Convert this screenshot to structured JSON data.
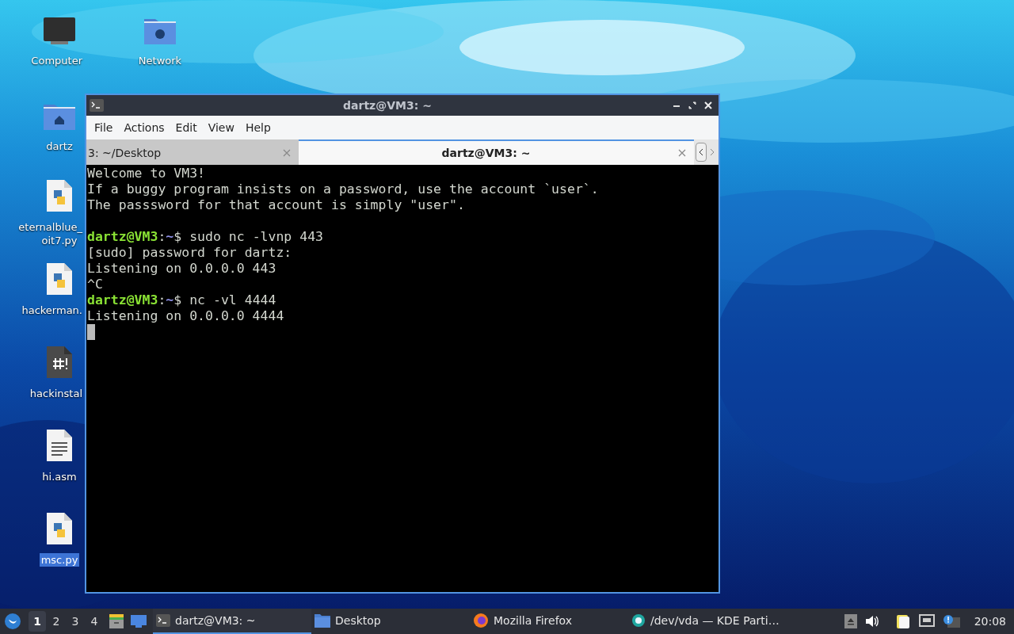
{
  "desktop_icons": [
    {
      "kind": "monitor",
      "label": [
        "Computer"
      ],
      "selected": false
    },
    {
      "kind": "network-folder",
      "label": [
        "Network"
      ],
      "selected": false
    },
    {
      "kind": "home-folder",
      "label": [
        "dartz"
      ],
      "selected": false
    },
    {
      "kind": "python",
      "label": [
        "eternalblue_",
        "oit7.py"
      ],
      "selected": false
    },
    {
      "kind": "python",
      "label": [
        "hackerman."
      ],
      "selected": false
    },
    {
      "kind": "script",
      "label": [
        "hackinstal"
      ],
      "selected": false
    },
    {
      "kind": "text",
      "label": [
        "hi.asm"
      ],
      "selected": false
    },
    {
      "kind": "python",
      "label": [
        "msc.py"
      ],
      "selected": true
    }
  ],
  "window": {
    "title": "dartz@VM3: ~",
    "menu": [
      "File",
      "Actions",
      "Edit",
      "View",
      "Help"
    ],
    "tabs": [
      {
        "label": "3: ~/Desktop",
        "selected": false
      },
      {
        "label": "dartz@VM3: ~",
        "selected": true
      }
    ],
    "terminal": [
      {
        "kind": "output",
        "text": "Welcome to VM3!"
      },
      {
        "kind": "output",
        "text": "If a buggy program insists on a password, use the account `user`."
      },
      {
        "kind": "output",
        "text": "The passsword for that account is simply \"user\"."
      },
      {
        "kind": "blank"
      },
      {
        "kind": "prompt",
        "user": "dartz@VM3",
        "separator": ":",
        "path": "~",
        "symbol": "$",
        "command": "sudo nc -lvnp 443"
      },
      {
        "kind": "output",
        "text": "[sudo] password for dartz:"
      },
      {
        "kind": "output",
        "text": "Listening on 0.0.0.0 443"
      },
      {
        "kind": "output",
        "text": "^C"
      },
      {
        "kind": "prompt",
        "user": "dartz@VM3",
        "separator": ":",
        "path": "~",
        "symbol": "$",
        "command": "nc -vl 4444"
      },
      {
        "kind": "output",
        "text": "Listening on 0.0.0.0 4444"
      },
      {
        "kind": "cursor"
      }
    ]
  },
  "taskbar": {
    "workspaces": [
      {
        "label": "1",
        "selected": true
      },
      {
        "label": "2",
        "selected": false
      },
      {
        "label": "3",
        "selected": false
      },
      {
        "label": "4",
        "selected": false
      }
    ],
    "tasks": [
      {
        "kind": "terminal",
        "label": "dartz@VM3: ~",
        "selected": true
      },
      {
        "kind": "folder",
        "label": "Desktop",
        "selected": false
      },
      {
        "kind": "firefox",
        "label": "Mozilla Firefox",
        "selected": false
      },
      {
        "kind": "partition",
        "label": "/dev/vda — KDE Parti…",
        "selected": false
      }
    ],
    "clock": "20:08"
  }
}
